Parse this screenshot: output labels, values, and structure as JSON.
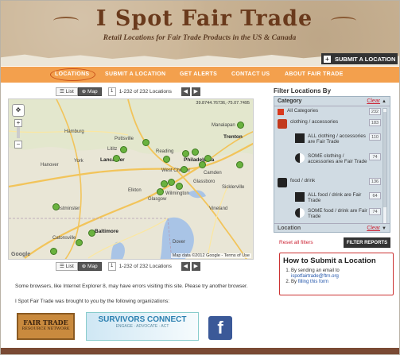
{
  "header": {
    "title": "I Spot Fair Trade",
    "subtitle": "Retail Locations for Fair Trade Products in the US & Canada",
    "submit_button": "SUBMIT A LOCATION"
  },
  "nav": {
    "items": [
      {
        "label": "LOCATIONS"
      },
      {
        "label": "SUBMIT A LOCATION"
      },
      {
        "label": "GET ALERTS"
      },
      {
        "label": "CONTACT US"
      },
      {
        "label": "ABOUT FAIR TRADE"
      }
    ]
  },
  "toolbar": {
    "list_label": "List",
    "map_label": "Map",
    "page": "1",
    "count": "1-232 of 232 Locations",
    "prev": "◀",
    "next": "▶"
  },
  "map": {
    "coords": "39.8744.76736,-75.07.7495",
    "footer": "Map data ©2012 Google - Terms of Use",
    "google": "Google",
    "cities": [
      {
        "name": "Hamburg"
      },
      {
        "name": "Lititz"
      },
      {
        "name": "Lancaster"
      },
      {
        "name": "Philadelphia"
      },
      {
        "name": "Trenton"
      },
      {
        "name": "West Chester"
      },
      {
        "name": "Camden"
      },
      {
        "name": "Glassboro"
      },
      {
        "name": "Baltimore"
      },
      {
        "name": "Elkton"
      },
      {
        "name": "Catonsville"
      },
      {
        "name": "Glasgow"
      },
      {
        "name": "Pottsville"
      },
      {
        "name": "Reading"
      },
      {
        "name": "Hanover"
      },
      {
        "name": "York"
      },
      {
        "name": "Westminster"
      },
      {
        "name": "Wilmington"
      },
      {
        "name": "Vineland"
      },
      {
        "name": "Dover"
      },
      {
        "name": "Sicklerville"
      },
      {
        "name": "Manalapan"
      }
    ]
  },
  "notes": {
    "browser": "Some browsers, like Internet Explorer 8, may have errors visiting this site. Please try another browser.",
    "brought": "I Spot Fair Trade was brought to you by the following organizations:"
  },
  "logos": {
    "ftrn": "FAIR TRADE",
    "ftrn_sub": "RESOURCE NETWORK",
    "survivors": "SURVIVORS CONNECT",
    "survivors_sub": "ENGAGE · ADVOCATE · ACT",
    "facebook": "f"
  },
  "filter": {
    "title": "Filter Locations By",
    "category_label": "Category",
    "clear": "Clear",
    "categories": [
      {
        "label": "All Categories",
        "count": "232"
      },
      {
        "label": "clothing / accessories",
        "count": "183"
      },
      {
        "label": "ALL clothing / accessories are Fair Trade",
        "count": "110"
      },
      {
        "label": "SOME clothing / accessories are Fair Trade",
        "count": "74"
      },
      {
        "label": "food / drink",
        "count": "136"
      },
      {
        "label": "ALL food / drink are Fair Trade",
        "count": "64"
      },
      {
        "label": "SOME food / drink are Fair Trade",
        "count": "74"
      }
    ],
    "location_label": "Location",
    "location_clear": "Clear",
    "reset": "Reset all filters",
    "reports_button": "FILTER REPORTS"
  },
  "howto": {
    "title": "How to Submit a Location",
    "step1_prefix": "By sending an email to",
    "step1_email": "ispotfairtrade@ftrn.org",
    "step2_prefix": "By",
    "step2_link": "filling this form"
  },
  "colors": {
    "nav_orange": "#f3a04d",
    "header_tan": "#cbb596",
    "pin_green": "#6ab23f",
    "filter_blue": "#d0dbe3"
  }
}
